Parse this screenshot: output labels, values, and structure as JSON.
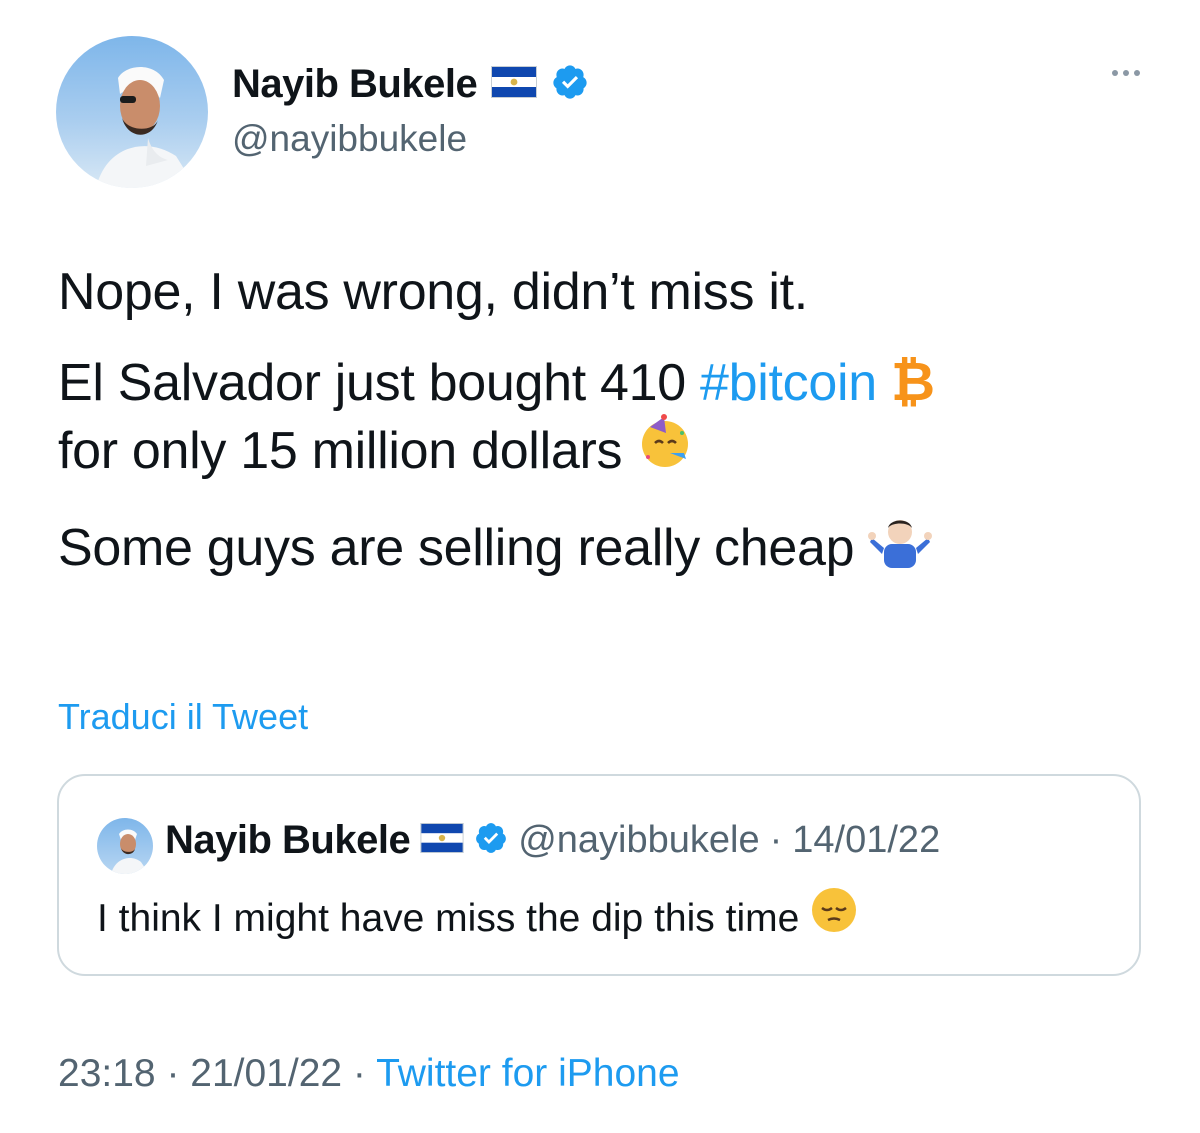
{
  "author": {
    "name": "Nayib Bukele",
    "handle": "@nayibbukele",
    "verified": true,
    "flag_icon": "el-salvador-flag-icon"
  },
  "more_icon": "ellipsis-icon",
  "tweet": {
    "line1": "Nope, I was wrong, didn’t miss it.",
    "line2_prefix": "El Salvador just bought 410 ",
    "hashtag": "#bitcoin",
    "bitcoin_emoji": "₿",
    "line2_suffix": "for only 15 million dollars",
    "line3": "Some guys are selling really cheap"
  },
  "translate_link": "Traduci il Tweet",
  "quoted_tweet": {
    "name": "Nayib Bukele",
    "handle": "@nayibbukele",
    "separator": "·",
    "date": "14/01/22",
    "text": "I think I might have miss the dip this time"
  },
  "footer": {
    "time": "23:18",
    "separator1": " · ",
    "date": "21/01/22",
    "separator2": " · ",
    "source": "Twitter for iPhone"
  },
  "colors": {
    "link": "#1d9bf0",
    "secondary_text": "#536471",
    "border": "#cfd9de",
    "bitcoin": "#f7931a"
  }
}
